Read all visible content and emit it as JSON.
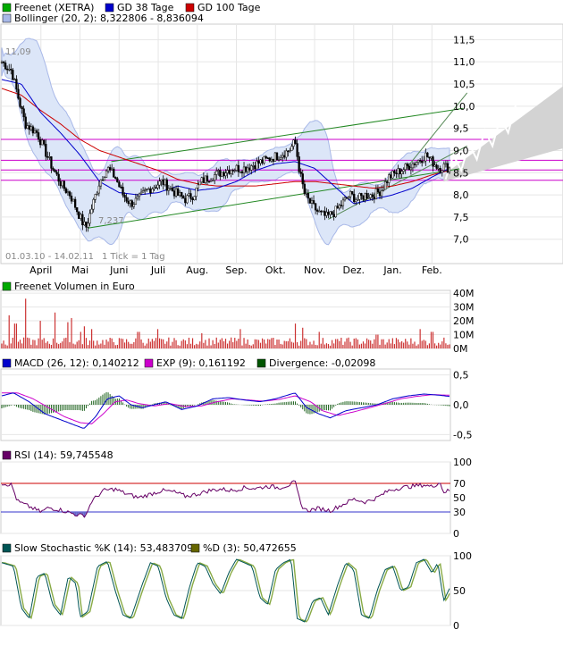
{
  "chart_data": [
    {
      "type": "candlestick",
      "panel": "price",
      "legend": [
        {
          "label": "Freenet (XETRA)",
          "color": "#00aa00"
        },
        {
          "label": "GD 38 Tage",
          "color": "#0000cc"
        },
        {
          "label": "GD 100 Tage",
          "color": "#cc0000"
        },
        {
          "label": "Bollinger (20, 2): 8,322806 - 8,836094",
          "color": "#a8b8e8"
        }
      ],
      "y_ticks": [
        "11,5",
        "11,0",
        "10,5",
        "10,0",
        "9,5",
        "9,0",
        "8,5",
        "8,0",
        "7,5",
        "7,0"
      ],
      "y_tick_values": [
        11.5,
        11.0,
        10.5,
        10.0,
        9.5,
        9.0,
        8.5,
        8.0,
        7.5,
        7.0
      ],
      "ylim": [
        6.45,
        11.85
      ],
      "x_ticks": [
        "April",
        "Mai",
        "Juni",
        "Juli",
        "Aug.",
        "Sep.",
        "Okt.",
        "Nov.",
        "Dez.",
        "Jan.",
        "Feb."
      ],
      "x_tick_months": [
        1,
        2,
        3,
        4,
        5,
        6,
        7,
        8,
        9,
        10,
        11
      ],
      "months_span": 11.45,
      "annotations": {
        "high": "11,09",
        "low": "7,237",
        "period": "01.03.10 - 14.02.11",
        "tick": "1 Tick = 1 Tag"
      },
      "close_anchors": [
        [
          0,
          11.0
        ],
        [
          0.25,
          10.8
        ],
        [
          0.45,
          10.1
        ],
        [
          0.6,
          9.6
        ],
        [
          0.9,
          9.4
        ],
        [
          1.1,
          9.0
        ],
        [
          1.3,
          8.6
        ],
        [
          1.55,
          8.2
        ],
        [
          1.75,
          8.0
        ],
        [
          1.9,
          7.7
        ],
        [
          2.05,
          7.4
        ],
        [
          2.15,
          7.25
        ],
        [
          2.3,
          7.7
        ],
        [
          2.5,
          8.3
        ],
        [
          2.7,
          8.6
        ],
        [
          2.9,
          8.4
        ],
        [
          3.1,
          8.0
        ],
        [
          3.3,
          7.8
        ],
        [
          3.5,
          7.9
        ],
        [
          3.7,
          8.1
        ],
        [
          3.9,
          8.2
        ],
        [
          4.1,
          8.3
        ],
        [
          4.3,
          8.15
        ],
        [
          4.5,
          8.0
        ],
        [
          4.7,
          7.9
        ],
        [
          4.9,
          8.0
        ],
        [
          5.1,
          8.3
        ],
        [
          5.3,
          8.4
        ],
        [
          5.6,
          8.5
        ],
        [
          5.9,
          8.6
        ],
        [
          6.2,
          8.6
        ],
        [
          6.5,
          8.7
        ],
        [
          6.8,
          8.8
        ],
        [
          7.1,
          8.9
        ],
        [
          7.35,
          9.0
        ],
        [
          7.5,
          9.2
        ],
        [
          7.62,
          8.5
        ],
        [
          7.75,
          8.0
        ],
        [
          7.9,
          7.8
        ],
        [
          8.1,
          7.6
        ],
        [
          8.3,
          7.5
        ],
        [
          8.5,
          7.6
        ],
        [
          8.7,
          7.8
        ],
        [
          8.9,
          8.0
        ],
        [
          9.1,
          7.9
        ],
        [
          9.3,
          8.0
        ],
        [
          9.5,
          8.0
        ],
        [
          9.7,
          8.1
        ],
        [
          9.9,
          8.4
        ],
        [
          10.1,
          8.5
        ],
        [
          10.3,
          8.6
        ],
        [
          10.5,
          8.7
        ],
        [
          10.7,
          8.8
        ],
        [
          10.85,
          8.9
        ],
        [
          11.0,
          8.75
        ],
        [
          11.2,
          8.6
        ],
        [
          11.3,
          8.65
        ],
        [
          11.45,
          8.6
        ]
      ],
      "gd38_anchors": [
        [
          0,
          10.6
        ],
        [
          0.5,
          10.5
        ],
        [
          1.0,
          9.85
        ],
        [
          1.5,
          9.4
        ],
        [
          2.0,
          8.9
        ],
        [
          2.5,
          8.3
        ],
        [
          3.0,
          8.05
        ],
        [
          3.5,
          8.0
        ],
        [
          4.0,
          8.05
        ],
        [
          4.5,
          8.2
        ],
        [
          5.0,
          8.1
        ],
        [
          5.5,
          8.15
        ],
        [
          6.0,
          8.3
        ],
        [
          6.5,
          8.55
        ],
        [
          7.0,
          8.7
        ],
        [
          7.5,
          8.75
        ],
        [
          8.0,
          8.6
        ],
        [
          8.5,
          8.2
        ],
        [
          9.0,
          7.8
        ],
        [
          9.5,
          7.9
        ],
        [
          10.0,
          8.0
        ],
        [
          10.5,
          8.15
        ],
        [
          11.0,
          8.4
        ],
        [
          11.45,
          8.6
        ]
      ],
      "gd100_anchors": [
        [
          0,
          10.4
        ],
        [
          0.5,
          10.25
        ],
        [
          1.0,
          9.9
        ],
        [
          1.5,
          9.6
        ],
        [
          2.0,
          9.25
        ],
        [
          2.5,
          9.0
        ],
        [
          3.0,
          8.85
        ],
        [
          3.5,
          8.7
        ],
        [
          4.0,
          8.55
        ],
        [
          4.5,
          8.35
        ],
        [
          5.0,
          8.25
        ],
        [
          5.5,
          8.2
        ],
        [
          6.0,
          8.2
        ],
        [
          6.5,
          8.2
        ],
        [
          7.0,
          8.25
        ],
        [
          7.5,
          8.3
        ],
        [
          8.0,
          8.3
        ],
        [
          8.5,
          8.25
        ],
        [
          9.0,
          8.2
        ],
        [
          9.5,
          8.15
        ],
        [
          10.0,
          8.2
        ],
        [
          10.5,
          8.3
        ],
        [
          11.0,
          8.45
        ],
        [
          11.45,
          8.55
        ]
      ],
      "h_lines": [
        9.25,
        8.78,
        8.56,
        8.33
      ],
      "h_line_color": "#cc00cc",
      "trend_channel_lower": [
        [
          2.2,
          7.25
        ],
        [
          11.8,
          8.6
        ]
      ],
      "trend_channel_upper": [
        [
          2.8,
          8.75
        ],
        [
          11.8,
          9.95
        ]
      ],
      "short_channel_lower": [
        [
          8.35,
          7.45
        ],
        [
          11.9,
          9.1
        ]
      ],
      "short_channel_upper": [
        [
          10.3,
          8.55
        ],
        [
          11.9,
          10.3
        ]
      ],
      "forecast_zigzag": [
        [
          11.35,
          8.35
        ],
        [
          11.55,
          8.9
        ],
        [
          11.75,
          8.55
        ],
        [
          11.95,
          9.15
        ],
        [
          12.15,
          8.8
        ],
        [
          12.35,
          9.45
        ],
        [
          12.55,
          9.1
        ],
        [
          12.75,
          9.75
        ],
        [
          12.95,
          9.4
        ],
        [
          13.15,
          10.05
        ]
      ]
    },
    {
      "type": "bar",
      "panel": "volume",
      "legend": [
        {
          "label": "Freenet Volumen in Euro",
          "color": "#00aa00"
        }
      ],
      "y_ticks": [
        "40M",
        "30M",
        "20M",
        "10M",
        "0M"
      ],
      "y_tick_values": [
        40,
        30,
        20,
        10,
        0
      ],
      "ylim": [
        0,
        42
      ],
      "unit": "M EUR",
      "spikes": [
        [
          0.2,
          24
        ],
        [
          0.35,
          18
        ],
        [
          0.6,
          36
        ],
        [
          1.0,
          20
        ],
        [
          1.35,
          26
        ],
        [
          1.7,
          19
        ],
        [
          1.8,
          22
        ],
        [
          2.0,
          12
        ],
        [
          2.1,
          16
        ],
        [
          2.3,
          14
        ],
        [
          3.5,
          12
        ],
        [
          4.0,
          14
        ],
        [
          5.1,
          11
        ],
        [
          6.1,
          14
        ],
        [
          7.5,
          18
        ],
        [
          7.7,
          15
        ],
        [
          8.1,
          12
        ],
        [
          9.6,
          10
        ],
        [
          10.7,
          14
        ],
        [
          11.0,
          12
        ]
      ],
      "base_level": 5
    },
    {
      "type": "line",
      "panel": "macd",
      "legend": [
        {
          "label": "MACD (26, 12): 0,140212",
          "color": "#0000cc"
        },
        {
          "label": "EXP (9): 0,161192",
          "color": "#cc00cc"
        },
        {
          "label": "Divergence: -0,02098",
          "color": "#005500"
        }
      ],
      "y_ticks": [
        "0,5",
        "0,0",
        "-0,5"
      ],
      "y_tick_values": [
        0.5,
        0.0,
        -0.5
      ],
      "ylim": [
        -0.6,
        0.6
      ],
      "macd_anchors": [
        [
          0,
          0.15
        ],
        [
          0.3,
          0.2
        ],
        [
          0.7,
          0.05
        ],
        [
          1.1,
          -0.15
        ],
        [
          1.5,
          -0.25
        ],
        [
          1.9,
          -0.35
        ],
        [
          2.1,
          -0.4
        ],
        [
          2.4,
          -0.2
        ],
        [
          2.7,
          0.1
        ],
        [
          3.0,
          0.15
        ],
        [
          3.3,
          0.0
        ],
        [
          3.6,
          -0.05
        ],
        [
          3.9,
          0.0
        ],
        [
          4.2,
          0.05
        ],
        [
          4.6,
          -0.08
        ],
        [
          5.0,
          -0.02
        ],
        [
          5.4,
          0.1
        ],
        [
          5.8,
          0.12
        ],
        [
          6.2,
          0.08
        ],
        [
          6.6,
          0.05
        ],
        [
          7.0,
          0.1
        ],
        [
          7.5,
          0.2
        ],
        [
          7.8,
          -0.05
        ],
        [
          8.1,
          -0.15
        ],
        [
          8.4,
          -0.22
        ],
        [
          8.8,
          -0.1
        ],
        [
          9.2,
          -0.05
        ],
        [
          9.6,
          0.0
        ],
        [
          10.0,
          0.1
        ],
        [
          10.4,
          0.15
        ],
        [
          10.8,
          0.18
        ],
        [
          11.2,
          0.16
        ],
        [
          11.45,
          0.14
        ]
      ],
      "exp_anchors": [
        [
          0,
          0.2
        ],
        [
          0.4,
          0.2
        ],
        [
          0.8,
          0.1
        ],
        [
          1.2,
          -0.05
        ],
        [
          1.6,
          -0.2
        ],
        [
          2.0,
          -0.3
        ],
        [
          2.3,
          -0.32
        ],
        [
          2.6,
          -0.15
        ],
        [
          2.9,
          0.05
        ],
        [
          3.2,
          0.08
        ],
        [
          3.5,
          0.02
        ],
        [
          3.9,
          -0.02
        ],
        [
          4.3,
          0.02
        ],
        [
          4.7,
          -0.03
        ],
        [
          5.1,
          -0.02
        ],
        [
          5.5,
          0.05
        ],
        [
          5.9,
          0.1
        ],
        [
          6.3,
          0.08
        ],
        [
          6.7,
          0.06
        ],
        [
          7.1,
          0.09
        ],
        [
          7.5,
          0.15
        ],
        [
          7.9,
          0.05
        ],
        [
          8.2,
          -0.1
        ],
        [
          8.6,
          -0.18
        ],
        [
          9.0,
          -0.12
        ],
        [
          9.4,
          -0.05
        ],
        [
          9.8,
          0.02
        ],
        [
          10.2,
          0.1
        ],
        [
          10.6,
          0.14
        ],
        [
          11.0,
          0.17
        ],
        [
          11.45,
          0.16
        ]
      ]
    },
    {
      "type": "line",
      "panel": "rsi",
      "legend": [
        {
          "label": "RSI (14): 59,745548",
          "color": "#660066"
        }
      ],
      "y_ticks": [
        "100",
        "70",
        "50",
        "30",
        "0"
      ],
      "y_tick_values": [
        100,
        70,
        50,
        30,
        0
      ],
      "ylim": [
        0,
        100
      ],
      "ref_lines": [
        70,
        30
      ],
      "rsi_anchors": [
        [
          0,
          70
        ],
        [
          0.25,
          68
        ],
        [
          0.4,
          45
        ],
        [
          0.6,
          40
        ],
        [
          0.8,
          35
        ],
        [
          1.0,
          30
        ],
        [
          1.2,
          36
        ],
        [
          1.5,
          33
        ],
        [
          1.8,
          28
        ],
        [
          2.0,
          25
        ],
        [
          2.15,
          26
        ],
        [
          2.3,
          45
        ],
        [
          2.6,
          60
        ],
        [
          2.9,
          62
        ],
        [
          3.2,
          55
        ],
        [
          3.5,
          50
        ],
        [
          3.8,
          55
        ],
        [
          4.1,
          60
        ],
        [
          4.4,
          58
        ],
        [
          4.7,
          52
        ],
        [
          5.0,
          55
        ],
        [
          5.3,
          60
        ],
        [
          5.6,
          62
        ],
        [
          5.9,
          60
        ],
        [
          6.2,
          64
        ],
        [
          6.5,
          63
        ],
        [
          6.8,
          66
        ],
        [
          7.1,
          64
        ],
        [
          7.35,
          68
        ],
        [
          7.5,
          72
        ],
        [
          7.65,
          40
        ],
        [
          7.8,
          32
        ],
        [
          8.1,
          35
        ],
        [
          8.4,
          32
        ],
        [
          8.7,
          40
        ],
        [
          9.0,
          48
        ],
        [
          9.3,
          44
        ],
        [
          9.6,
          50
        ],
        [
          9.9,
          60
        ],
        [
          10.2,
          64
        ],
        [
          10.5,
          66
        ],
        [
          10.8,
          68
        ],
        [
          11.0,
          65
        ],
        [
          11.2,
          72
        ],
        [
          11.3,
          58
        ],
        [
          11.45,
          60
        ]
      ]
    },
    {
      "type": "line",
      "panel": "stochastic",
      "legend": [
        {
          "label": "Slow Stochastic %K (14): 53,483709",
          "color": "#005555"
        },
        {
          "label": "%D (3): 50,472655",
          "color": "#666600"
        }
      ],
      "y_ticks": [
        "100",
        "50",
        "0"
      ],
      "y_tick_values": [
        100,
        50,
        0
      ],
      "ylim": [
        0,
        100
      ],
      "k_anchors": [
        [
          0,
          90
        ],
        [
          0.3,
          85
        ],
        [
          0.5,
          25
        ],
        [
          0.7,
          10
        ],
        [
          0.9,
          70
        ],
        [
          1.1,
          75
        ],
        [
          1.3,
          30
        ],
        [
          1.5,
          15
        ],
        [
          1.7,
          70
        ],
        [
          1.9,
          60
        ],
        [
          2.0,
          12
        ],
        [
          2.2,
          20
        ],
        [
          2.45,
          85
        ],
        [
          2.7,
          92
        ],
        [
          2.9,
          50
        ],
        [
          3.1,
          15
        ],
        [
          3.3,
          10
        ],
        [
          3.6,
          60
        ],
        [
          3.8,
          90
        ],
        [
          4.0,
          85
        ],
        [
          4.2,
          40
        ],
        [
          4.4,
          15
        ],
        [
          4.6,
          10
        ],
        [
          4.8,
          55
        ],
        [
          5.0,
          90
        ],
        [
          5.2,
          85
        ],
        [
          5.4,
          60
        ],
        [
          5.6,
          45
        ],
        [
          5.8,
          75
        ],
        [
          6.0,
          95
        ],
        [
          6.2,
          90
        ],
        [
          6.4,
          85
        ],
        [
          6.6,
          40
        ],
        [
          6.8,
          30
        ],
        [
          7.0,
          80
        ],
        [
          7.2,
          90
        ],
        [
          7.4,
          95
        ],
        [
          7.55,
          10
        ],
        [
          7.75,
          5
        ],
        [
          7.95,
          35
        ],
        [
          8.15,
          40
        ],
        [
          8.35,
          15
        ],
        [
          8.6,
          60
        ],
        [
          8.8,
          90
        ],
        [
          9.0,
          80
        ],
        [
          9.2,
          15
        ],
        [
          9.4,
          10
        ],
        [
          9.6,
          50
        ],
        [
          9.8,
          80
        ],
        [
          10.0,
          85
        ],
        [
          10.2,
          50
        ],
        [
          10.4,
          55
        ],
        [
          10.6,
          90
        ],
        [
          10.8,
          95
        ],
        [
          11.0,
          75
        ],
        [
          11.15,
          90
        ],
        [
          11.3,
          35
        ],
        [
          11.45,
          53
        ]
      ]
    }
  ]
}
